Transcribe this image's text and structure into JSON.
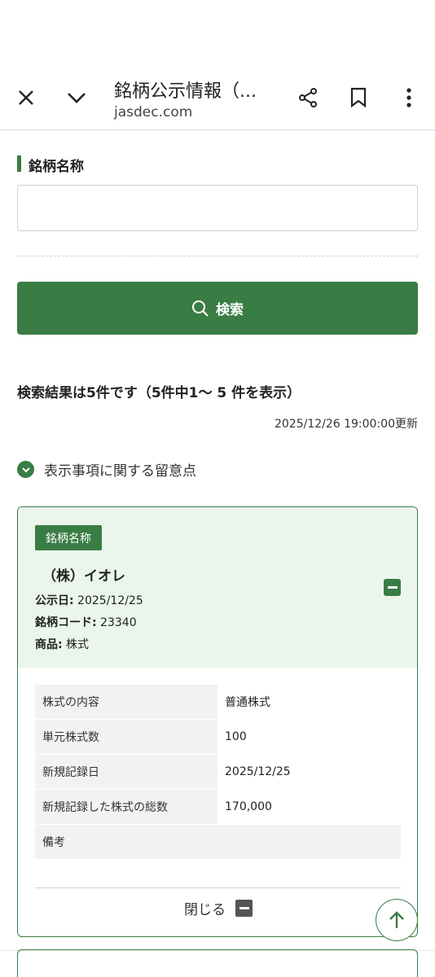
{
  "toolbar": {
    "title": "銘柄公示情報（...",
    "url": "jasdec.com"
  },
  "form": {
    "field_label": "銘柄名称",
    "input_value": "",
    "input_placeholder": "",
    "search_label": "検索"
  },
  "results": {
    "summary": "検索結果は5件です（5件中1〜 5 件を表示）",
    "updated": "2025/12/26 19:00:00更新",
    "notice": "表示事項に関する留意点"
  },
  "card": {
    "badge": "銘柄名称",
    "company": "（株）イオレ",
    "meta": [
      {
        "label": "公示日:",
        "value": " 2025/12/25"
      },
      {
        "label": "銘柄コード:",
        "value": " 23340"
      },
      {
        "label": "商品:",
        "value": " 株式"
      }
    ],
    "details": [
      {
        "key": "株式の内容",
        "value": "普通株式"
      },
      {
        "key": "単元株式数",
        "value": "100"
      },
      {
        "key": "新規記録日",
        "value": "2025/12/25"
      },
      {
        "key": "新規記録した株式の総数",
        "value": "170,000"
      },
      {
        "key": "備考",
        "value": ""
      }
    ],
    "close_label": "閉じる"
  },
  "colors": {
    "accent": "#3a7d44",
    "card_bg": "#eaf5ec"
  }
}
